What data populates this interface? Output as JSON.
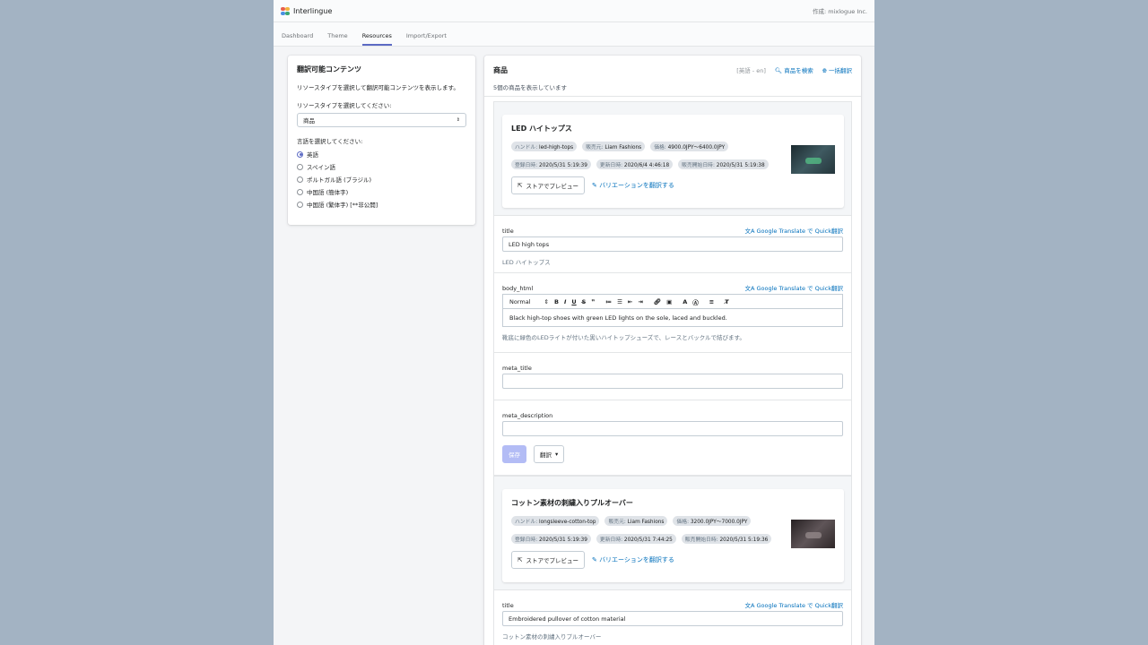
{
  "app": {
    "name": "Interlingue",
    "author": "作成: mixlogue Inc."
  },
  "tabs": [
    "Dashboard",
    "Theme",
    "Resources",
    "Import/Export"
  ],
  "left": {
    "title": "翻訳可能コンテンツ",
    "desc": "リソースタイプを選択して翻訳可能コンテンツを表示します。",
    "select_label": "リソースタイプを選択してください:",
    "select_value": "商品",
    "lang_label": "言語を選択してください:",
    "languages": [
      "英語",
      "スペイン語",
      "ポルトガル語 (ブラジル)",
      "中国語 (簡体字)",
      "中国語 (繁体字) [**非公開]"
    ]
  },
  "right": {
    "title": "商品",
    "lang_tag": "[英語 - en]",
    "search_label": "商品を検索",
    "bulk_label": "一括翻訳",
    "count": "5個の商品を表示しています",
    "preview_label": "ストアでプレビュー",
    "variations_label": "バリエーションを翻訳する",
    "quick_label": "Google Translate で Quick翻訳",
    "save_label": "保存",
    "translate_label": "翻訳",
    "products": [
      {
        "title": "LED ハイトップス",
        "handle_k": "ハンドル:",
        "handle": "led-high-tops",
        "vendor_k": "販売元:",
        "vendor": "Liam Fashions",
        "price_k": "価格:",
        "price": "4900.0JPY〜6400.0JPY",
        "created_k": "登録日時:",
        "created": "2020/5/31 5:19:39",
        "updated_k": "更新日時:",
        "updated": "2020/6/4 4:46:18",
        "published_k": "販売開始日時:",
        "published": "2020/5/31 5:19:38",
        "fields": {
          "title_label": "title",
          "title_value": "LED high tops",
          "title_src": "LED ハイトップス",
          "body_label": "body_html",
          "body_value": "Black high-top shoes with green LED lights on the sole, laced and buckled.",
          "body_src": "靴底に緑色のLEDライトが付いた黒いハイトップシューズで、レースとバックルで結びます。",
          "meta_title_label": "meta_title",
          "meta_desc_label": "meta_description",
          "editor_format": "Normal"
        }
      },
      {
        "title": "コットン素材の刺繍入りプルオーバー",
        "handle_k": "ハンドル:",
        "handle": "longsleeve-cotton-top",
        "vendor_k": "販売元:",
        "vendor": "Liam Fashions",
        "price_k": "価格:",
        "price": "3200.0JPY〜7000.0JPY",
        "created_k": "登録日時:",
        "created": "2020/5/31 5:19:39",
        "updated_k": "更新日時:",
        "updated": "2020/5/31 7:44:25",
        "published_k": "販売開始日時:",
        "published": "2020/5/31 5:19:36",
        "fields": {
          "title_label": "title",
          "title_value": "Embroidered pullover of cotton material",
          "title_src": "コットン素材の刺繍入りプルオーバー"
        }
      }
    ]
  }
}
